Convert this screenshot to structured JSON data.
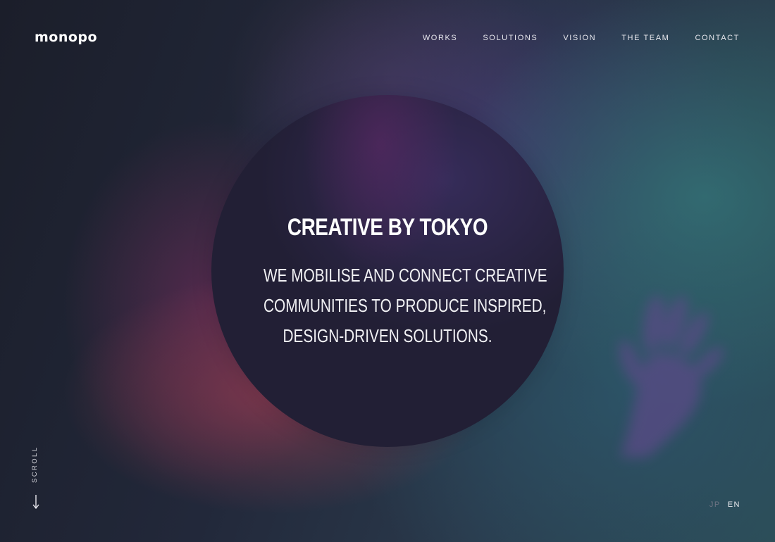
{
  "header": {
    "logo": "monopo",
    "nav": [
      {
        "label": "WORKS"
      },
      {
        "label": "SOLUTIONS"
      },
      {
        "label": "VISION"
      },
      {
        "label": "THE TEAM"
      },
      {
        "label": "CONTACT"
      }
    ]
  },
  "hero": {
    "title": "CREATIVE BY TOKYO",
    "lines": [
      "WE MOBILISE AND CONNECT CREATIVE",
      "COMMUNITIES TO PRODUCE INSPIRED,",
      "DESIGN-DRIVEN SOLUTIONS."
    ]
  },
  "scroll": {
    "label": "SCROLL",
    "icon": "arrow-down-icon"
  },
  "language": {
    "options": [
      "JP",
      "EN"
    ],
    "active": "EN"
  },
  "colors": {
    "text": "#ffffff",
    "circle": "#221f35",
    "inactive_lang": "#6f7484"
  }
}
